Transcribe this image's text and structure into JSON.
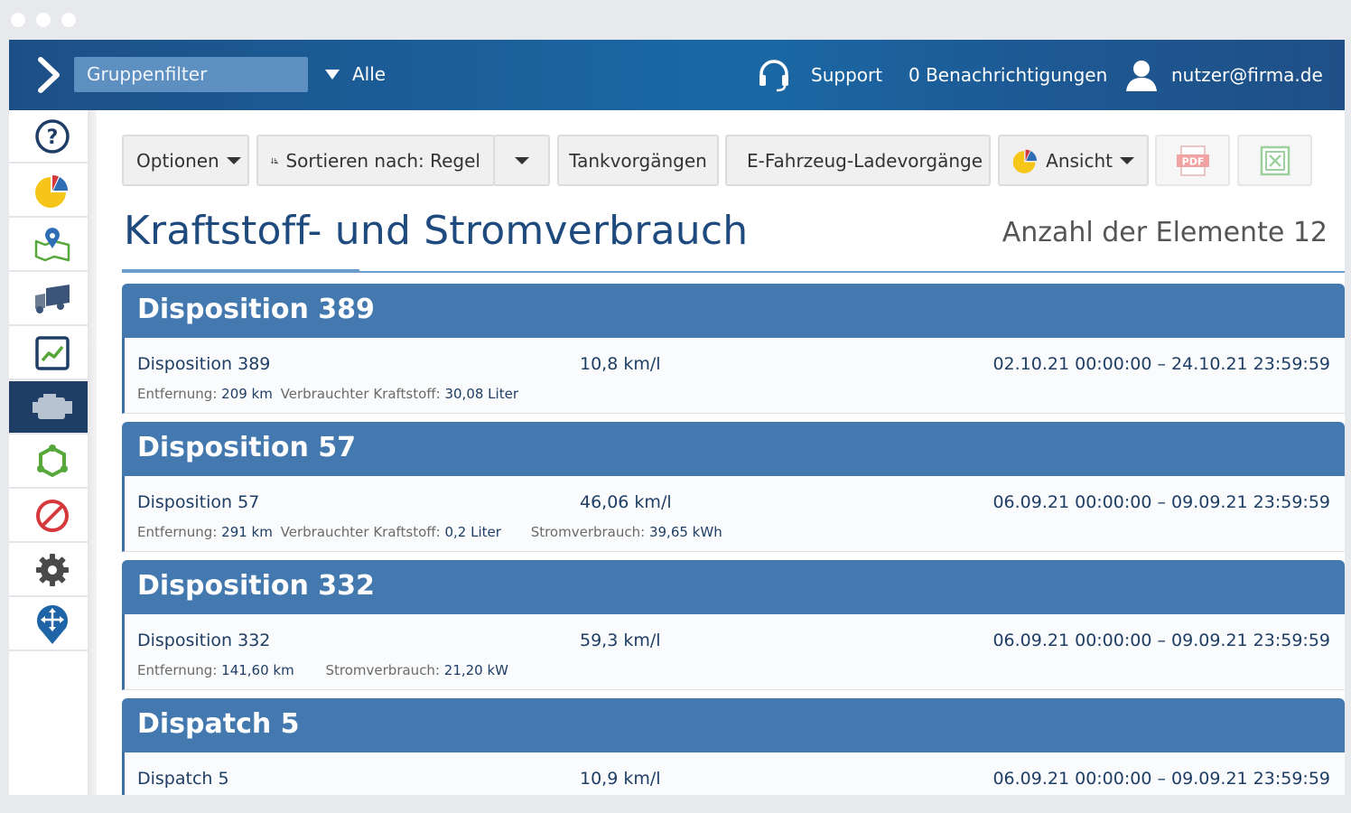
{
  "header": {
    "group_filter_label": "Gruppenfilter",
    "group_filter_value": "Alle",
    "support": "Support",
    "notifications": "0 Benachrichtigungen",
    "user": "nutzer@firma.de"
  },
  "sidebar": {
    "items": [
      {
        "icon": "help-icon"
      },
      {
        "icon": "pie-chart-icon"
      },
      {
        "icon": "map-pin-icon"
      },
      {
        "icon": "truck-icon"
      },
      {
        "icon": "trend-chart-icon"
      },
      {
        "icon": "engine-icon",
        "active": true
      },
      {
        "icon": "route-network-icon"
      },
      {
        "icon": "prohibited-icon"
      },
      {
        "icon": "gear-icon"
      },
      {
        "icon": "location-move-icon"
      }
    ]
  },
  "toolbar": {
    "options": "Optionen",
    "sort": "Sortieren nach: Regel",
    "refuel": "Tankvorgängen",
    "ev_charging": "E-Fahrzeug-Ladevorgänge",
    "view": "Ansicht",
    "pdf": "PDF"
  },
  "main": {
    "title": "Kraftstoff- und Stromverbrauch",
    "count": "Anzahl der Elemente 12",
    "cards": [
      {
        "header": "Disposition 389",
        "name": "Disposition 389",
        "efficiency": "10,8 km/l",
        "date_range": "02.10.21 00:00:00 – 24.10.21 23:59:59",
        "details": [
          {
            "label": "Entfernung:",
            "value": "209 km"
          },
          {
            "label": "Verbrauchter Kraftstoff:",
            "value": "30,08 Liter"
          }
        ]
      },
      {
        "header": "Disposition 57",
        "name": "Disposition 57",
        "efficiency": "46,06 km/l",
        "date_range": "06.09.21 00:00:00 – 09.09.21 23:59:59",
        "details": [
          {
            "label": "Entfernung:",
            "value": "291 km"
          },
          {
            "label": "Verbrauchter Kraftstoff:",
            "value": "0,2 Liter"
          },
          {
            "label": "Stromverbrauch:",
            "value": "39,65 kWh"
          }
        ]
      },
      {
        "header": "Disposition 332",
        "name": "Disposition 332",
        "efficiency": "59,3 km/l",
        "date_range": "06.09.21 00:00:00 – 09.09.21 23:59:59",
        "details": [
          {
            "label": "Entfernung:",
            "value": "141,60 km"
          },
          {
            "label": "Stromverbrauch:",
            "value": "21,20 kW"
          }
        ]
      },
      {
        "header": "Dispatch 5",
        "name": "Dispatch 5",
        "efficiency": "10,9 km/l",
        "date_range": "06.09.21 00:00:00 – 09.09.21 23:59:59",
        "details": []
      }
    ]
  }
}
